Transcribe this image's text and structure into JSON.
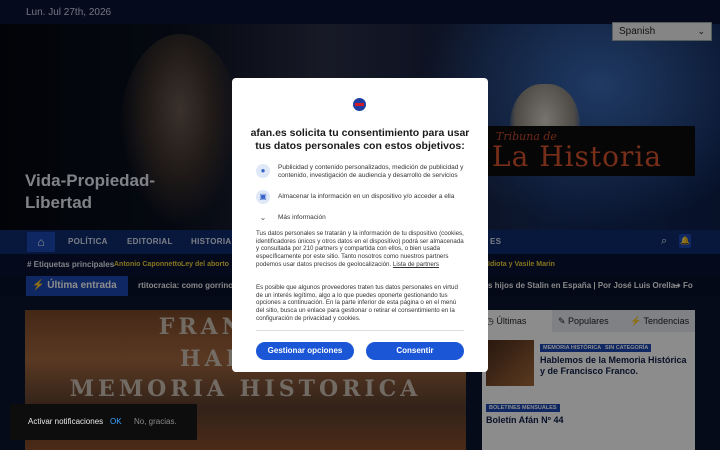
{
  "topbar": {
    "date": "Lun. Jul 27th, 2026"
  },
  "hero": {
    "tagline": "Vida-Propiedad-Libertad"
  },
  "language": {
    "selected": "Spanish"
  },
  "logo": {
    "top": "Tribuna de",
    "main": "La Historia"
  },
  "nav": {
    "items": [
      "POLÍTICA",
      "EDITORIAL",
      "HISTORIA",
      "ES"
    ]
  },
  "tags": {
    "label": "# Etiquetas principales",
    "items": [
      "Antonio Caponnetto",
      "Ley del aborto",
      "Idiota y Vasile Marin"
    ]
  },
  "ticker": {
    "label": "Última entrada",
    "left": "rtitocracia: como gorrino en",
    "right": "s hijos de Stalin en España | Por José Luis Orella.",
    "far": "Fo"
  },
  "banner": {
    "lines": [
      "FRANCO, Y",
      "HABLAR",
      "MEMORIA HISTORICA"
    ]
  },
  "sidebar": {
    "tabs": [
      "Últimas",
      "Populares",
      "Tendencias"
    ],
    "post1": {
      "badges": [
        "MEMORIA HISTÓRICA",
        "SIN CATEGORÍA"
      ],
      "title": "Hablemos de la Memoria Histórica y de Francisco Franco."
    },
    "post2": {
      "badges": [
        "BOLETINES MENSUALES"
      ],
      "title": "Boletín Afán Nº 44"
    }
  },
  "consent": {
    "title": "afan.es solicita tu consentimiento para usar tus datos personales con estos objetivos:",
    "purposes": [
      "Publicidad y contenido personalizados, medición de publicidad y contenido, investigación de audiencia y desarrollo de servicios",
      "Almacenar la información en un dispositivo y/o acceder a ella",
      "Más información"
    ],
    "para1": "Tus datos personales se tratarán y la información de tu dispositivo (cookies, identificadores únicos y otros datos en el dispositivo) podrá ser almacenada y consultada por 210 partners y compartida con ellos, o bien usada específicamente por este sitio. Tanto nosotros como nuestros partners podemos usar datos precisos de geolocalización.",
    "para1_link": "Lista de partners",
    "para2": "Es posible que algunos proveedores traten tus datos personales en virtud de un interés legítimo, algo a lo que puedes oponerte gestionando tus opciones a continuación. En la parte inferior de esta página o en el menú del sitio, busca un enlace para gestionar o retirar el consentimiento en la configuración de privacidad y cookies.",
    "manage_button": "Gestionar opciones",
    "consent_button": "Consentir"
  },
  "notifications": {
    "text": "Activar notificaciones",
    "ok": "OK",
    "no": "No, gracias."
  }
}
